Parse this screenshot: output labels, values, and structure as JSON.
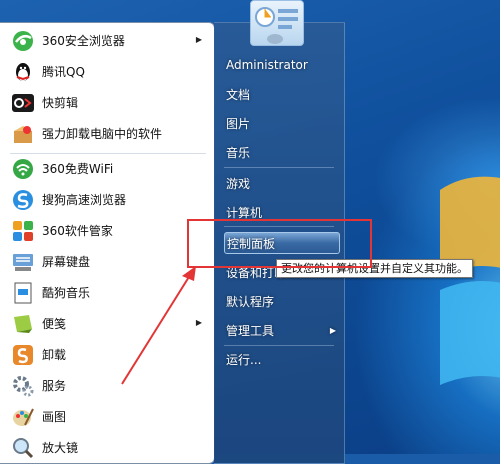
{
  "start_menu": {
    "programs": [
      {
        "label": "360安全浏览器",
        "icon": "360-browser-icon",
        "has_submenu": true
      },
      {
        "label": "腾讯QQ",
        "icon": "qq-penguin-icon",
        "has_submenu": false
      },
      {
        "label": "快剪辑",
        "icon": "quick-edit-icon",
        "has_submenu": false
      },
      {
        "label": "强力卸载电脑中的软件",
        "icon": "uninstall-box-icon",
        "has_submenu": false
      },
      {
        "label": "360免费WiFi",
        "icon": "wifi-icon",
        "has_submenu": false
      },
      {
        "label": "搜狗高速浏览器",
        "icon": "sogou-browser-icon",
        "has_submenu": false
      },
      {
        "label": "360软件管家",
        "icon": "software-manager-icon",
        "has_submenu": false
      },
      {
        "label": "屏幕键盘",
        "icon": "keyboard-icon",
        "has_submenu": false
      },
      {
        "label": "酷狗音乐",
        "icon": "kugou-music-icon",
        "has_submenu": false
      },
      {
        "label": "便笺",
        "icon": "sticky-note-icon",
        "has_submenu": true
      },
      {
        "label": "卸载",
        "icon": "uninstall-icon",
        "has_submenu": false
      },
      {
        "label": "服务",
        "icon": "services-gear-icon",
        "has_submenu": false
      },
      {
        "label": "画图",
        "icon": "paint-icon",
        "has_submenu": false
      },
      {
        "label": "放大镜",
        "icon": "magnifier-icon",
        "has_submenu": false
      }
    ],
    "places": [
      {
        "label": "Administrator",
        "has_submenu": false
      },
      {
        "label": "文档",
        "has_submenu": false
      },
      {
        "label": "图片",
        "has_submenu": false
      },
      {
        "label": "音乐",
        "has_submenu": false
      },
      {
        "label": "游戏",
        "has_submenu": false
      },
      {
        "label": "计算机",
        "has_submenu": false
      },
      {
        "label": "控制面板",
        "has_submenu": false,
        "highlighted": true
      },
      {
        "label": "设备和打印",
        "has_submenu": false
      },
      {
        "label": "默认程序",
        "has_submenu": false
      },
      {
        "label": "管理工具",
        "has_submenu": true
      },
      {
        "label": "运行...",
        "has_submenu": false
      }
    ],
    "tooltip": "更改您的计算机设置并自定义其功能。"
  },
  "colors": {
    "highlight_border": "#e33535",
    "right_pane": "#2b5a94",
    "desktop": "#1a5ca8"
  }
}
